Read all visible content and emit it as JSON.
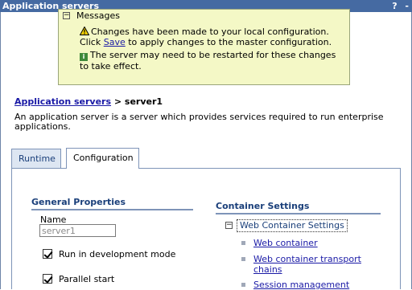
{
  "window": {
    "title": "Application servers",
    "help_icon": "?",
    "minimize_icon": "-"
  },
  "messages": {
    "title": "Messages",
    "toggle": "−",
    "warning_prefix": "Changes have been made to your local configuration.",
    "warning_click": "Click ",
    "warning_link": "Save",
    "warning_suffix": " to apply changes to the master configuration.",
    "info_text": "The server may need to be restarted for these changes to take effect."
  },
  "breadcrumb": {
    "link": "Application servers",
    "separator": " > ",
    "current": "server1"
  },
  "description": "An application server is a server which provides services required to run enterprise applications.",
  "tabs": [
    {
      "label": "Runtime"
    },
    {
      "label": "Configuration"
    }
  ],
  "general_properties": {
    "heading": "General Properties",
    "name_label": "Name",
    "name_value": "server1",
    "dev_mode_label": "Run in development mode",
    "dev_mode_checked": true,
    "parallel_label": "Parallel start",
    "parallel_checked": true
  },
  "container_settings": {
    "heading": "Container Settings",
    "toggle": "−",
    "group_label": "Web Container Settings",
    "links": [
      {
        "label": "Web container"
      },
      {
        "label": "Web container transport chains"
      },
      {
        "label": "Session management"
      }
    ]
  }
}
